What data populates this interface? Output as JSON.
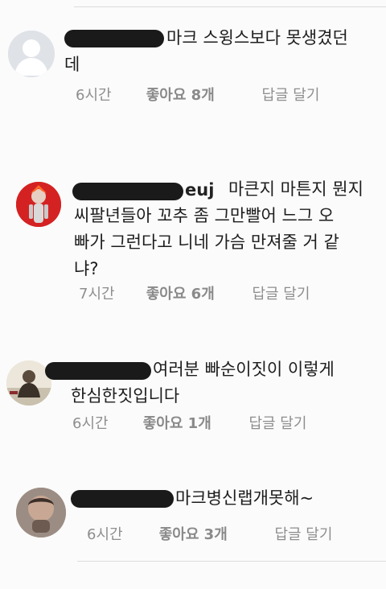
{
  "comments": [
    {
      "username_visible": "",
      "text": "마크 스윙스보다 못생겼던\n데",
      "time": "6시간",
      "likes": "좋아요 8개",
      "reply": "답글 달기"
    },
    {
      "username_visible": "euj",
      "text": "마큰지 마튼지 뭔지\n씨팔년들아 꼬추 좀 그만빨어 느그 오\n빠가 그런다고 니네 가슴 만져줄 거 같\n냐?",
      "time": "7시간",
      "likes": "좋아요 6개",
      "reply": "답글 달기"
    },
    {
      "username_visible": "",
      "text": "여러분 빠순이짓이 이렇게\n한심한짓입니다",
      "time": "6시간",
      "likes": "좋아요 1개",
      "reply": "답글 달기"
    },
    {
      "username_visible": "",
      "text": "마크병신랩개못해~",
      "time": "6시간",
      "likes": "좋아요 3개",
      "reply": "답글 달기"
    }
  ]
}
